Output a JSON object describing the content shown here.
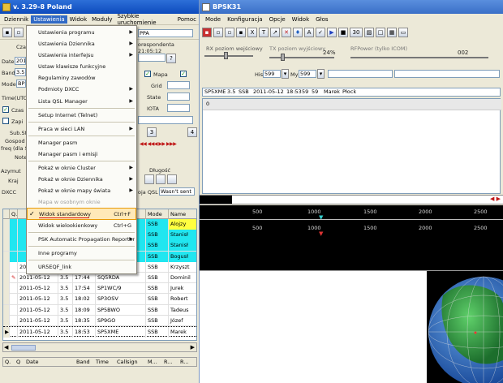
{
  "left": {
    "title": "v. 3.29-8 Poland",
    "menu": [
      "Dziennik",
      "Ustawienia",
      "Widok",
      "Moduły",
      "Szybkie uruchomienie",
      "Pomoc"
    ],
    "callsign_partial": "PPA",
    "correspondents": "orespondenta 21:05:12",
    "labels": {
      "czas": "Cza",
      "date": "Date",
      "band": "Band",
      "mode": "Mode",
      "timeutc": "Time(UTC",
      "czas2": "Czas",
      "zapi": "Zapi",
      "subst": "Sub.St",
      "gospod": "Gospod",
      "freq": "freq (dla SY",
      "note": "Note",
      "azymut": "Azymut",
      "kraj": "Kraj",
      "dxcc": "DXCC",
      "mapa": "Mapa",
      "grid": "Grid",
      "state": "State",
      "iota": "IOTA",
      "dlugosc": "Długość",
      "qsl": "oja QSL",
      "qsl_value": "Wasn't sent"
    },
    "field_values": {
      "date": "2011",
      "band": "3.5",
      "mode": "BPS",
      "grid_n": "3",
      "grid_n2": "4"
    },
    "dropdown": {
      "items": [
        {
          "label": "Ustawienia programu",
          "arrow": true
        },
        {
          "label": "Ustawienia Dziennika",
          "arrow": true
        },
        {
          "label": "Ustawienia interfejsu",
          "arrow": true
        },
        {
          "label": "Ustaw klawisze funkcyjne"
        },
        {
          "label": "Regulaminy zawodów"
        },
        {
          "label": "Podmioty DXCC",
          "arrow": true
        },
        {
          "label": "Lista QSL Manager",
          "arrow": true
        },
        {
          "sep": true
        },
        {
          "label": "Setup Internet (Telnet)"
        },
        {
          "sep": true
        },
        {
          "label": "Praca w sieci LAN",
          "arrow": true
        },
        {
          "sep": true
        },
        {
          "label": "Manager pasm"
        },
        {
          "label": "Manager pasm i emisji"
        },
        {
          "sep": true
        },
        {
          "label": "Pokaż w oknie Cluster",
          "arrow": true
        },
        {
          "label": "Pokaż w oknie Dziennika",
          "arrow": true
        },
        {
          "label": "Pokaż w oknie mapy świata",
          "arrow": true
        },
        {
          "label": "Mapa w osobnym oknie",
          "disabled": true
        },
        {
          "label": "Widok standardowy",
          "shortcut": "Ctrl+F",
          "checked": true,
          "selected": true
        },
        {
          "label": "Widok wielookienkowy",
          "shortcut": "Ctrl+G"
        },
        {
          "sep": true
        },
        {
          "label": "PSK Automatic Propagation Reporter",
          "arrow": true
        },
        {
          "sep": true
        },
        {
          "label": "Inne programy"
        },
        {
          "sep": true
        },
        {
          "label": "UR5EQF_link"
        }
      ]
    },
    "grid": {
      "headers": [
        "",
        "Q.",
        "",
        "",
        "Mode",
        "Name"
      ],
      "bottom_headers": [
        "Q.",
        "Q",
        "Date",
        "Band",
        "Time",
        "Callsign",
        "M...",
        "R...",
        "R..."
      ],
      "rows": [
        {
          "date": "",
          "band": "",
          "time": "",
          "call": "",
          "mode": "SSB",
          "name": "Alojzy",
          "hl": true
        },
        {
          "date": "",
          "band": "",
          "time": "",
          "call": "",
          "mode": "SSB",
          "name": "Stanisł",
          "hl": true
        },
        {
          "date": "",
          "band": "",
          "time": "",
          "call": "",
          "mode": "SSB",
          "name": "Stanisł",
          "hl": true
        },
        {
          "date": "",
          "band": "",
          "time": "",
          "call": "",
          "mode": "SSB",
          "name": "Bogusł",
          "hl": true
        },
        {
          "date": "2011-05-12",
          "band": "3.5",
          "time": "17:29",
          "call": "SP7QLH",
          "mode": "SSB",
          "name": "Krzyszt"
        },
        {
          "date": "2011-05-12",
          "band": "3.5",
          "time": "17:44",
          "call": "SQ5RDA",
          "mode": "SSB",
          "name": "Dominil",
          "pin": true
        },
        {
          "date": "2011-05-12",
          "band": "3.5",
          "time": "17:54",
          "call": "SP1WC/9",
          "mode": "SSB",
          "name": "Jurek"
        },
        {
          "date": "2011-05-12",
          "band": "3.5",
          "time": "18:02",
          "call": "SP3OSV",
          "mode": "SSB",
          "name": "Robert"
        },
        {
          "date": "2011-05-12",
          "band": "3.5",
          "time": "18:09",
          "call": "SP5BWO",
          "mode": "SSB",
          "name": "Tadeus"
        },
        {
          "date": "2011-05-12",
          "band": "3.5",
          "time": "18:35",
          "call": "SP9GO",
          "mode": "SSB",
          "name": "Józef"
        },
        {
          "date": "2011-05-12",
          "band": "3.5",
          "time": "18:53",
          "call": "SP5XME",
          "mode": "SSB",
          "name": "Marek",
          "current": true
        }
      ]
    }
  },
  "right": {
    "title": "BPSK31",
    "menu": [
      "Mode",
      "Konfiguracja",
      "Opcje",
      "Widok",
      "Głos"
    ],
    "rx_label": "RX poziom wejściowy",
    "tx_label": "TX poziom wyjściowy",
    "tx_pct": "24%",
    "rfpower_label": "RFPower (tylko ICOM)",
    "rfpower_value": "002",
    "zoom_value": "30",
    "his_label": "His",
    "my_label": "My",
    "his_rst": "599",
    "my_rst": "599",
    "log_line": [
      "SP5XME",
      "3.5",
      "SSB",
      "2011-05-12",
      "18:53",
      "59",
      "59",
      "Marek",
      "Płock"
    ],
    "rx_line": "0",
    "scale_ticks": [
      "500",
      "1000",
      "1500",
      "2000",
      "2500"
    ]
  }
}
